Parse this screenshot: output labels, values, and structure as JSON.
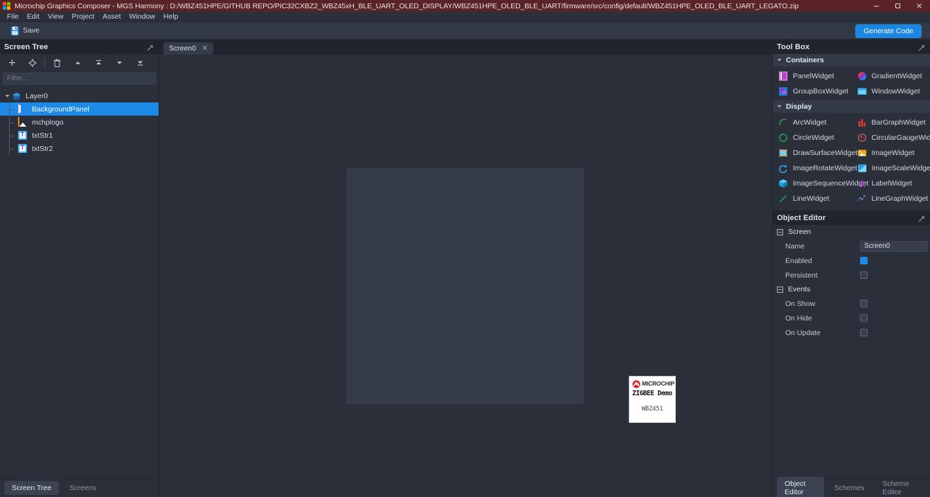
{
  "window": {
    "title": "Microchip Graphics Composer - MGS Harmony : D:/WBZ451HPE/GITHUB REPO/PIC32CXBZ2_WBZ45xH_BLE_UART_OLED_DISPLAY/WBZ451HPE_OLED_BLE_UART/firmware/src/config/default/WBZ451HPE_OLED_BLE_UART_LEGATO.zip",
    "titlebar_color": "#5a2326",
    "controls": {
      "minimize": "minimize-icon",
      "maximize": "maximize-icon",
      "close": "close-icon"
    }
  },
  "menubar": {
    "items": [
      {
        "label": "File"
      },
      {
        "label": "Edit"
      },
      {
        "label": "View"
      },
      {
        "label": "Project"
      },
      {
        "label": "Asset"
      },
      {
        "label": "Window"
      },
      {
        "label": "Help"
      }
    ]
  },
  "toolbar": {
    "save_label": "Save",
    "generate_code_label": "Generate Code",
    "accent_color": "#1b87e0"
  },
  "screen_tree": {
    "title": "Screen Tree",
    "filter_placeholder": "Filter...",
    "tools": [
      {
        "name": "add-button",
        "glyph": "+"
      },
      {
        "name": "target-button",
        "glyph": "target"
      },
      {
        "name": "delete-button",
        "glyph": "trash"
      },
      {
        "name": "move-up-button",
        "glyph": "up"
      },
      {
        "name": "move-to-top-button",
        "glyph": "top"
      },
      {
        "name": "move-down-button",
        "glyph": "down"
      },
      {
        "name": "move-to-bottom-button",
        "glyph": "bottom"
      }
    ],
    "nodes": [
      {
        "label": "Layer0",
        "icon": "layer-icon",
        "depth": 0,
        "selected": false,
        "expanded": true
      },
      {
        "label": "BackgroundPanel",
        "icon": "panel-icon",
        "depth": 1,
        "selected": true
      },
      {
        "label": "mchplogo",
        "icon": "image-icon",
        "depth": 1,
        "selected": false
      },
      {
        "label": "txtStr1",
        "icon": "text-icon",
        "depth": 1,
        "selected": false
      },
      {
        "label": "txtStr2",
        "icon": "text-icon",
        "depth": 1,
        "selected": false
      }
    ],
    "selection_color": "#1d8ae8",
    "bottom_tabs": [
      {
        "label": "Screen Tree",
        "active": true
      },
      {
        "label": "Screens",
        "active": false
      }
    ]
  },
  "editor": {
    "tabs": [
      {
        "label": "Screen0",
        "close": "✕",
        "active": true
      }
    ],
    "device_preview": {
      "brand": "MICROCHIP",
      "line1": "ZIGBEE Demo",
      "line2": "WBZ451",
      "background": "#ffffff"
    }
  },
  "toolbox": {
    "title": "Tool Box",
    "sections": [
      {
        "name": "Containers",
        "items": [
          {
            "label": "PanelWidget",
            "icon": "panel-widget-icon"
          },
          {
            "label": "GradientWidget",
            "icon": "gradient-widget-icon"
          },
          {
            "label": "GroupBoxWidget",
            "icon": "groupbox-widget-icon"
          },
          {
            "label": "WindowWidget",
            "icon": "window-widget-icon"
          }
        ]
      },
      {
        "name": "Display",
        "items": [
          {
            "label": "ArcWidget",
            "icon": "arc-widget-icon"
          },
          {
            "label": "BarGraphWidget",
            "icon": "bargraph-widget-icon"
          },
          {
            "label": "CircleWidget",
            "icon": "circle-widget-icon"
          },
          {
            "label": "CircularGaugeWidget",
            "icon": "circulargauge-widget-icon"
          },
          {
            "label": "DrawSurfaceWidget",
            "icon": "drawsurface-widget-icon"
          },
          {
            "label": "ImageWidget",
            "icon": "image-widget-icon"
          },
          {
            "label": "ImageRotateWidget",
            "icon": "imagerotate-widget-icon"
          },
          {
            "label": "ImageScaleWidget",
            "icon": "imagescale-widget-icon"
          },
          {
            "label": "ImageSequenceWidget",
            "icon": "imagesequence-widget-icon"
          },
          {
            "label": "LabelWidget",
            "icon": "label-widget-icon"
          },
          {
            "label": "LineWidget",
            "icon": "line-widget-icon"
          },
          {
            "label": "LineGraphWidget",
            "icon": "linegraph-widget-icon"
          }
        ]
      }
    ]
  },
  "object_editor": {
    "title": "Object Editor",
    "groups": [
      {
        "name": "Screen",
        "rows": [
          {
            "label": "Name",
            "type": "text",
            "value": "Screen0"
          },
          {
            "label": "Enabled",
            "type": "checkbox",
            "checked": true
          },
          {
            "label": "Persistent",
            "type": "checkbox",
            "checked": false
          }
        ]
      },
      {
        "name": "Events",
        "rows": [
          {
            "label": "On Show",
            "type": "checkbox",
            "checked": false
          },
          {
            "label": "On Hide",
            "type": "checkbox",
            "checked": false
          },
          {
            "label": "On Update",
            "type": "checkbox",
            "checked": false
          }
        ]
      }
    ],
    "bottom_tabs": [
      {
        "label": "Object Editor",
        "active": true
      },
      {
        "label": "Schemes",
        "active": false
      },
      {
        "label": "Scheme Editor",
        "active": false
      }
    ]
  }
}
